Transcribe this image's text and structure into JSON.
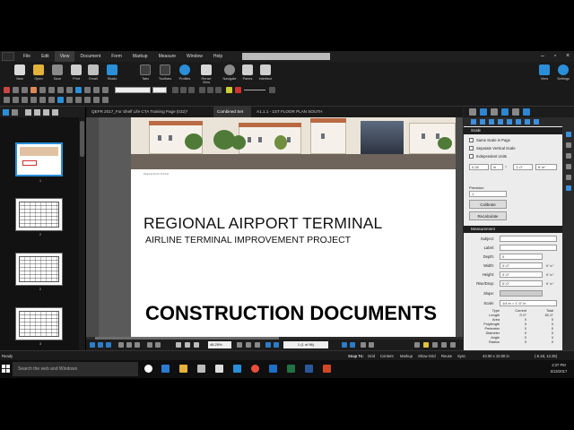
{
  "menu": {
    "items": [
      "File",
      "Edit",
      "View",
      "Document",
      "Form",
      "Markup",
      "Measure",
      "Window",
      "Help"
    ],
    "active_index": 2
  },
  "ribbon": {
    "left_buttons": [
      "New",
      "Open",
      "Save",
      "Print",
      "Email",
      "Studio"
    ],
    "mid_buttons": [
      "Tabs",
      "Toolbars",
      "Profiles",
      "Reuse View",
      "Navigate",
      "Panes",
      "Interface"
    ],
    "right_buttons": [
      "View",
      "Settings"
    ]
  },
  "thumbnails": {
    "pages": [
      "1",
      "2",
      "2",
      "3"
    ],
    "selected_index": 0
  },
  "doc_tabs": {
    "items": [
      "QEFR 2017_For Shelf Life CTA Training Page (032)*",
      "Combined Set",
      "A1.1.1 - 1ST FLOOR PLAN SOUTH"
    ],
    "active_index": 1
  },
  "document": {
    "caption": "Regional Airport Terminal",
    "title": "REGIONAL AIRPORT TERMINAL",
    "subtitle": "AIRLINE TERMINAL IMPROVEMENT PROJECT",
    "heading": "CONSTRUCTION DOCUMENTS"
  },
  "viewbar": {
    "zoom": "48.25%",
    "page_indicator": "1 (1 of 96)"
  },
  "properties": {
    "scale_section": "Scale",
    "checkboxes": [
      "Same Scale in Page",
      "Separate Vertical Scale",
      "Independent Units"
    ],
    "scale_left_value": "0.25",
    "scale_left_unit": "in",
    "scale_right_value": "1'-0\"",
    "scale_right_unit": "ft' in\"",
    "precision_label": "Precision",
    "precision_value": "1",
    "calibrate_label": "Calibrate",
    "recalculate_label": "Recalculate",
    "measurement_section": "Measurement",
    "subject_label": "Subject:",
    "label_label": "Label:",
    "depth_label": "Depth:",
    "depth_value": "0",
    "width_label": "Width:",
    "width_value": "0'-0\"",
    "height_label": "Height:",
    "height_value": "0'-0\"",
    "rise_label": "Rise/Drop:",
    "rise_value": "0'-0\"",
    "slope_label": "Slope:",
    "scale_label": "Scale:",
    "scale_value": "1/4 in = 1'-0\" in",
    "ft_in_unit": "ft' in\"",
    "table_headers": [
      "Type",
      "Current",
      "Total"
    ],
    "table_rows": [
      [
        "Length",
        "0'-0\"",
        "16'-0\""
      ],
      [
        "Area",
        "0",
        "0"
      ],
      [
        "Polylength",
        "0",
        "0"
      ],
      [
        "Perimeter",
        "0",
        "0"
      ],
      [
        "Diameter",
        "0",
        "0"
      ],
      [
        "Angle",
        "0",
        "0"
      ],
      [
        "Radius",
        "0",
        "0"
      ]
    ]
  },
  "statusbar": {
    "left": "Ready",
    "snap_to": "Snap To:",
    "toggles": [
      "Grid",
      "Content",
      "Markup",
      "Show Grid",
      "Reuse",
      "Sync"
    ],
    "dimensions": "43.00 x 10.00 in",
    "coords": "(-5.18, 12.25)"
  },
  "taskbar": {
    "search_placeholder": "Search the web and Windows",
    "time": "2:37 PM",
    "date": "5/15/2017"
  },
  "colors": {
    "accent": "#2a8fd8",
    "ribbon_bg": "#1a1a1a",
    "panel_bg": "#ececec"
  }
}
